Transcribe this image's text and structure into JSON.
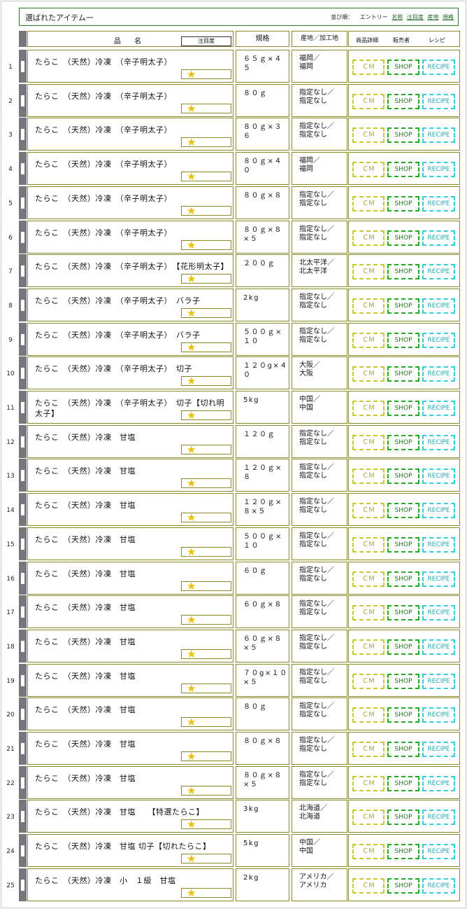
{
  "header": {
    "title": "選ばれたアイテム一",
    "sort_label": "並び順：",
    "sort_options": [
      "エントリー",
      "名称",
      "注目度",
      "産地",
      "規格"
    ]
  },
  "columns": {
    "name": "品 名",
    "attention": "注目度",
    "spec": "規格",
    "origin": "産地／加工地",
    "detail": "商品詳細",
    "seller": "販売者",
    "recipe": "レシピ"
  },
  "buttons": {
    "cm": "ＣＭ",
    "shop": "SHOP",
    "recipe": "RECIPE"
  },
  "items": [
    {
      "no": "1",
      "name": "たらこ　（天然）冷凍　（辛子明太子）",
      "spec": "６５ｇ×４５",
      "origin": "福岡／福岡"
    },
    {
      "no": "2",
      "name": "たらこ　（天然）冷凍　（辛子明太子）",
      "spec": "８０ｇ",
      "origin": "指定なし／指定なし"
    },
    {
      "no": "3",
      "name": "たらこ　（天然）冷凍　（辛子明太子）",
      "spec": "８０ｇ×３６",
      "origin": "指定なし／指定なし"
    },
    {
      "no": "4",
      "name": "たらこ　（天然）冷凍　（辛子明太子）",
      "spec": "８０ｇ×４０",
      "origin": "福岡／福岡"
    },
    {
      "no": "5",
      "name": "たらこ　（天然）冷凍　（辛子明太子）",
      "spec": "８０ｇ×８",
      "origin": "指定なし／指定なし"
    },
    {
      "no": "6",
      "name": "たらこ　（天然）冷凍　（辛子明太子）",
      "spec": "８０ｇ×８×５",
      "origin": "指定なし／指定なし"
    },
    {
      "no": "7",
      "name": "たらこ　（天然）冷凍　（辛子明太子）　【花形明太子】",
      "spec": "２００ｇ",
      "origin": "北太平洋／北太平洋"
    },
    {
      "no": "8",
      "name": "たらこ　（天然）冷凍　（辛子明太子）　バラ子",
      "spec": "2kg",
      "origin": "指定なし／指定なし"
    },
    {
      "no": "9",
      "name": "たらこ　（天然）冷凍　（辛子明太子）　バラ子",
      "spec": "５００ｇ×１０",
      "origin": "指定なし／指定なし"
    },
    {
      "no": "10",
      "name": "たらこ　（天然）冷凍　（辛子明太子）　切子",
      "spec": "１２０g×４０",
      "origin": "大阪／大阪"
    },
    {
      "no": "11",
      "name": "たらこ　（天然）冷凍　（辛子明太子）　切子【切れ明太子】",
      "spec": "5kg",
      "origin": "中国／中国"
    },
    {
      "no": "12",
      "name": "たらこ　（天然）冷凍　甘塩",
      "spec": "１２０ｇ",
      "origin": "指定なし／指定なし"
    },
    {
      "no": "13",
      "name": "たらこ　（天然）冷凍　甘塩",
      "spec": "１２０ｇ×８",
      "origin": "指定なし／指定なし"
    },
    {
      "no": "14",
      "name": "たらこ　（天然）冷凍　甘塩",
      "spec": "１２０ｇ×８×５",
      "origin": "指定なし／指定なし"
    },
    {
      "no": "15",
      "name": "たらこ　（天然）冷凍　甘塩",
      "spec": "５００ｇ×１０",
      "origin": "指定なし／指定なし"
    },
    {
      "no": "16",
      "name": "たらこ　（天然）冷凍　甘塩",
      "spec": "６０ｇ",
      "origin": "指定なし／指定なし"
    },
    {
      "no": "17",
      "name": "たらこ　（天然）冷凍　甘塩",
      "spec": "６０ｇ×８",
      "origin": "指定なし／指定なし"
    },
    {
      "no": "18",
      "name": "たらこ　（天然）冷凍　甘塩",
      "spec": "６０ｇ×８×５",
      "origin": "指定なし／指定なし"
    },
    {
      "no": "19",
      "name": "たらこ　（天然）冷凍　甘塩",
      "spec": "７０g×１０×５",
      "origin": "指定なし／指定なし"
    },
    {
      "no": "20",
      "name": "たらこ　（天然）冷凍　甘塩",
      "spec": "８０ｇ",
      "origin": "指定なし／指定なし"
    },
    {
      "no": "21",
      "name": "たらこ　（天然）冷凍　甘塩",
      "spec": "８０ｇ×８",
      "origin": "指定なし／指定なし"
    },
    {
      "no": "22",
      "name": "たらこ　（天然）冷凍　甘塩",
      "spec": "８０ｇ×８×５",
      "origin": "指定なし／指定なし"
    },
    {
      "no": "23",
      "name": "たらこ　（天然）冷凍　甘塩　　【特選たらこ】",
      "spec": "3kg",
      "origin": "北海道／北海道"
    },
    {
      "no": "24",
      "name": "たらこ　（天然）冷凍　甘塩 切子【切れたらこ】",
      "spec": "5kg",
      "origin": "中国／中国"
    },
    {
      "no": "25",
      "name": "たらこ　（天然）冷凍　小　１級　甘塩",
      "spec": "2kg",
      "origin": "アメリカ／アメリカ"
    }
  ],
  "colors": {
    "frame": "#8a8a2a",
    "cm": "#c8c830",
    "shop": "#22aa22",
    "recipe": "#33d0dc",
    "star": "#e8c200"
  }
}
